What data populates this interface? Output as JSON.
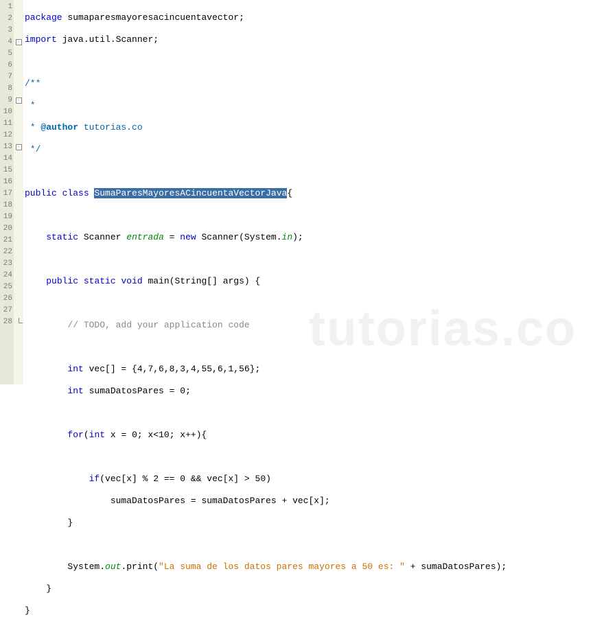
{
  "gutter": [
    "1",
    "2",
    "3",
    "4",
    "5",
    "6",
    "7",
    "8",
    "9",
    "10",
    "11",
    "12",
    "13",
    "14",
    "15",
    "16",
    "17",
    "18",
    "19",
    "20",
    "21",
    "22",
    "23",
    "24",
    "25",
    "26",
    "27",
    "28"
  ],
  "fold": [
    "",
    "",
    "",
    "box",
    "",
    "",
    "",
    "",
    "box",
    "",
    "",
    "",
    "box",
    "",
    "",
    "",
    "",
    "",
    "",
    "",
    "",
    "",
    "",
    "",
    "",
    "",
    "",
    "end"
  ],
  "code": {
    "l1": {
      "pkg": "package",
      "name": "sumaparesmayoresacincuentavector",
      "semi": ";"
    },
    "l2": {
      "imp": "import",
      "path": "java.util.Scanner",
      "semi": ";"
    },
    "l4": "/**",
    "l5": " *",
    "l6_a": " * ",
    "l6_tag": "@author",
    "l6_b": " tutorias.co",
    "l7": " */",
    "l9": {
      "pub": "public",
      "cls": "class",
      "name": "SumaParesMayoresACincuentaVectorJava",
      "brace": "{"
    },
    "l11": {
      "stat": "static",
      "typ": "Scanner ",
      "fld": "entrada",
      "eq": " = ",
      "nw": "new",
      "ctor": " Scanner(System.",
      "in": "in",
      "end": ");"
    },
    "l13": {
      "pub": "public",
      "stat": "static",
      "void": "void",
      "main": " main(String[] args) {"
    },
    "l15": "// TODO, add your application code",
    "l17": {
      "int": "int",
      "rest": " vec[] = {",
      "nums": "4,7,6,8,3,4,55,6,1,56",
      "end": "};"
    },
    "l18": {
      "int": "int",
      "rest": " sumaDatosPares = ",
      "num": "0",
      "semi": ";"
    },
    "l20": {
      "for": "for",
      "paren": "(",
      "int": "int",
      "mid": " x = ",
      "z": "0",
      "sep1": "; x<",
      "ten": "10",
      "sep2": "; x++){"
    },
    "l22": {
      "if": "if",
      "a": "(vec[x] % ",
      "two": "2",
      "b": " == ",
      "zero": "0",
      "c": " && vec[x] > ",
      "fifty": "50",
      "d": ")"
    },
    "l23": "                sumaDatosPares = sumaDatosPares + vec[x];",
    "l24": "        }",
    "l26": {
      "a": "        System.",
      "out": "out",
      "b": ".print(",
      "str": "\"La suma de los datos pares mayores a 50 es: \"",
      "c": " + sumaDatosPares);"
    },
    "l27": "    }",
    "l28": "}"
  },
  "watermark": "tutorias.co"
}
